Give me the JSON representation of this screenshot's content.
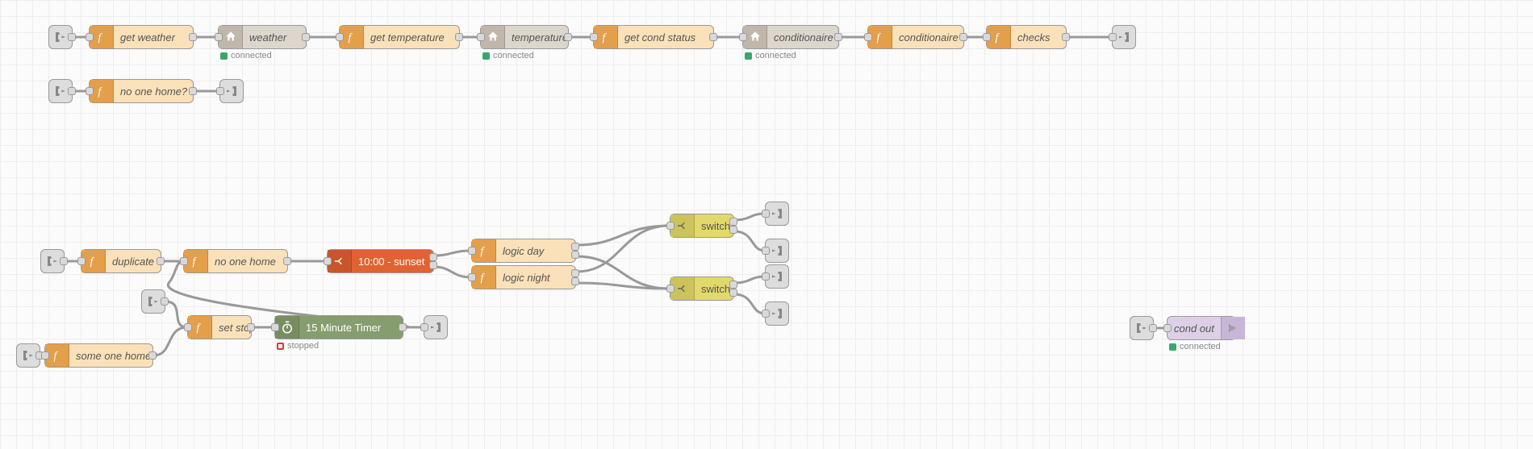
{
  "nodes": {
    "get_weather": {
      "label": "get weather"
    },
    "weather": {
      "label": "weather",
      "status": "connected",
      "status_color": "#3aa76d"
    },
    "get_temperature": {
      "label": "get temperature"
    },
    "temperature": {
      "label": "temperature",
      "status": "connected",
      "status_color": "#3aa76d"
    },
    "get_cond_status": {
      "label": "get cond status"
    },
    "conditionaire_e": {
      "label": "conditionaire",
      "status": "connected",
      "status_color": "#3aa76d"
    },
    "conditionaire_f": {
      "label": "conditionaire"
    },
    "checks": {
      "label": "checks"
    },
    "no_one_home_q": {
      "label": "no one home?"
    },
    "duplicate": {
      "label": "duplicate"
    },
    "no_one_home": {
      "label": "no one home"
    },
    "ten_sunset": {
      "label": "10:00 - sunset"
    },
    "logic_day": {
      "label": "logic day"
    },
    "logic_night": {
      "label": "logic night"
    },
    "switch1": {
      "label": "switch"
    },
    "switch2": {
      "label": "switch"
    },
    "set_stop": {
      "label": "set stop"
    },
    "timer": {
      "label": "15 Minute Timer",
      "status": "stopped",
      "status_color": "#d93636"
    },
    "some_one_home_q": {
      "label": "some one home?"
    },
    "cond_out": {
      "label": "cond out",
      "status": "connected",
      "status_color": "#3aa76d"
    }
  }
}
